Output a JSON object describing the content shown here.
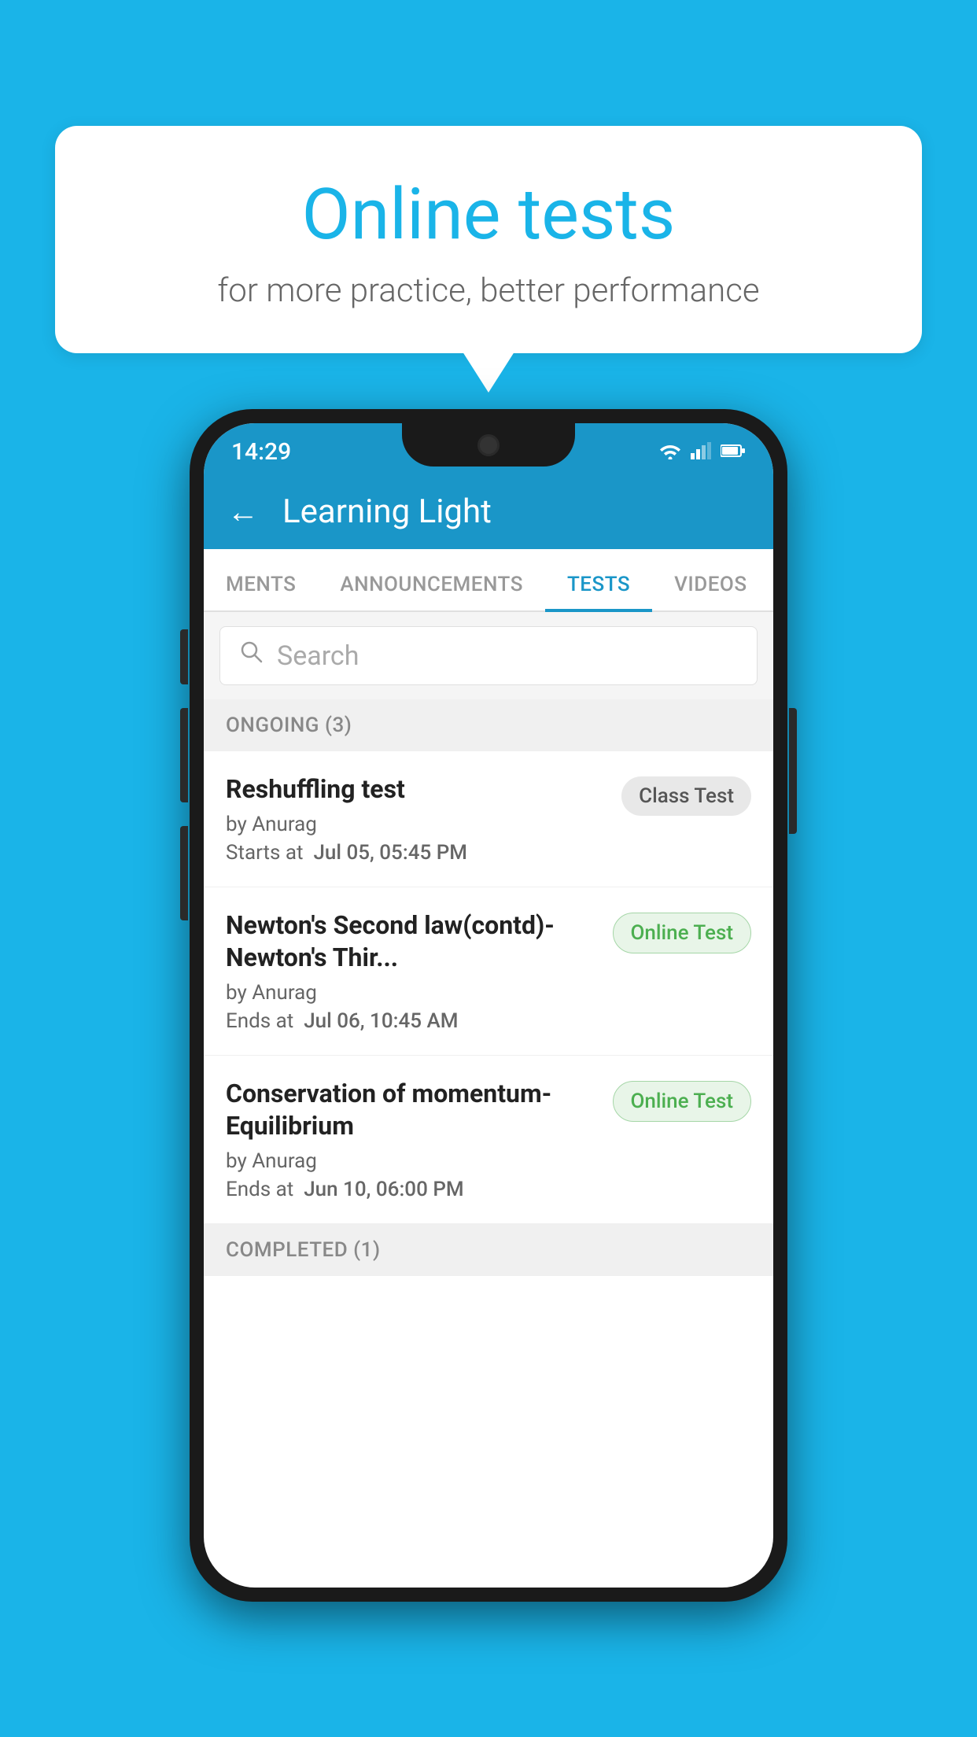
{
  "background": {
    "color": "#1ab4e8"
  },
  "speech_bubble": {
    "title": "Online tests",
    "subtitle": "for more practice, better performance"
  },
  "phone": {
    "status_bar": {
      "time": "14:29",
      "wifi": "▼",
      "signal": "▲",
      "battery": "▮"
    },
    "header": {
      "title": "Learning Light",
      "back_label": "←"
    },
    "tabs": [
      {
        "label": "MENTS",
        "active": false
      },
      {
        "label": "ANNOUNCEMENTS",
        "active": false
      },
      {
        "label": "TESTS",
        "active": true
      },
      {
        "label": "VIDEOS",
        "active": false
      }
    ],
    "search": {
      "placeholder": "Search"
    },
    "sections": [
      {
        "header": "ONGOING (3)",
        "items": [
          {
            "title": "Reshuffling test",
            "author": "by Anurag",
            "date_label": "Starts at",
            "date": "Jul 05, 05:45 PM",
            "badge": "Class Test",
            "badge_type": "class"
          },
          {
            "title": "Newton's Second law(contd)-Newton's Thir...",
            "author": "by Anurag",
            "date_label": "Ends at",
            "date": "Jul 06, 10:45 AM",
            "badge": "Online Test",
            "badge_type": "online"
          },
          {
            "title": "Conservation of momentum-Equilibrium",
            "author": "by Anurag",
            "date_label": "Ends at",
            "date": "Jun 10, 06:00 PM",
            "badge": "Online Test",
            "badge_type": "online"
          }
        ]
      },
      {
        "header": "COMPLETED (1)",
        "items": []
      }
    ]
  }
}
